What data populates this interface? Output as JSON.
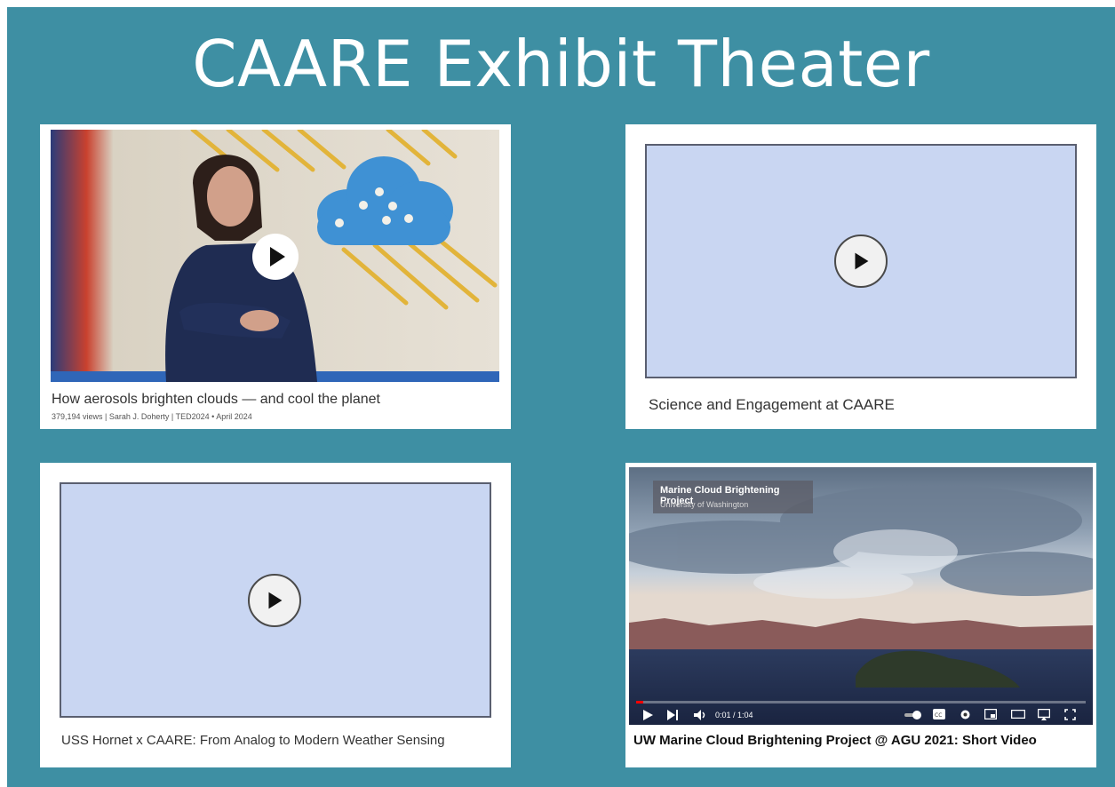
{
  "slide": {
    "title": "CAARE Exhibit Theater"
  },
  "videos": [
    {
      "caption": "How aerosols brighten clouds — and cool the planet",
      "meta": "379,194 views | Sarah J. Doherty | TED2024 • April 2024"
    },
    {
      "caption": "Science and Engagement at CAARE"
    },
    {
      "caption": "USS Hornet x CAARE: From Analog to Modern Weather Sensing"
    },
    {
      "caption": "UW Marine Cloud Brightening Project @ AGU 2021: Short Video",
      "overlay_title": "Marine Cloud Brightening Project",
      "overlay_subtitle": "University of Washington",
      "time": "0:01 / 1:04",
      "progress": 0.016
    }
  ],
  "colors": {
    "slide_bg": "#3e8fa3",
    "placeholder_bg": "#c9d6f2"
  },
  "icons": [
    "play-icon",
    "next-icon",
    "volume-icon",
    "autoplay-toggle-icon",
    "captions-icon",
    "settings-icon",
    "miniplayer-icon",
    "theater-mode-icon",
    "cast-icon",
    "fullscreen-icon"
  ]
}
